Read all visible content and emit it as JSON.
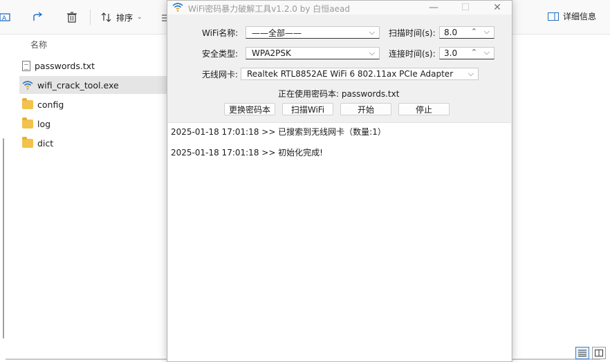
{
  "explorer": {
    "toolbar": {
      "sort_label": "排序",
      "details_label": "详细信息"
    },
    "column_header": "名称",
    "files": [
      {
        "name": "passwords.txt",
        "type": "text-file-icon"
      },
      {
        "name": "wifi_crack_tool.exe",
        "type": "wifi-app-icon",
        "selected": true
      },
      {
        "name": "config",
        "type": "folder-icon"
      },
      {
        "name": "log",
        "type": "folder-icon"
      },
      {
        "name": "dict",
        "type": "folder-icon"
      }
    ]
  },
  "app": {
    "title": "WiFi密码暴力破解工具v1.2.0 by 白恒aead",
    "wifi_name_label": "WiFi名称:",
    "wifi_name_value": "——全部——",
    "scan_time_label": "扫描时间(s):",
    "scan_time_value": "8.0",
    "security_label": "安全类型:",
    "security_value": "WPA2PSK",
    "connect_time_label": "连接时间(s):",
    "connect_time_value": "3.0",
    "adapter_label": "无线网卡:",
    "adapter_value": "Realtek RTL8852AE WiFi 6 802.11ax PCIe Adapter",
    "dict_info": "正在使用密码本: passwords.txt",
    "buttons": {
      "change_dict": "更换密码本",
      "scan_wifi": "扫描WiFi",
      "start": "开始",
      "stop": "停止"
    },
    "log": [
      "2025-01-18 17:01:18 >> 已搜索到无线网卡（数量:1）",
      "2025-01-18 17:01:18 >> 初始化完成!"
    ]
  },
  "colors": {
    "accent": "#0067c0",
    "folder": "#f3c24c",
    "selected_row": "#e5e5e5"
  }
}
